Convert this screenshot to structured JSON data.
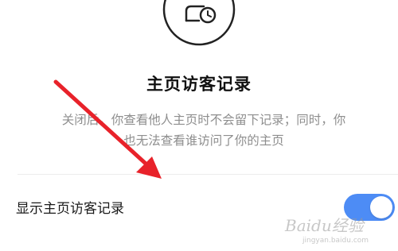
{
  "header": {
    "icon": "history-clock-icon"
  },
  "section": {
    "title": "主页访客记录",
    "description_line1": "关闭后，你查看他人主页时不会留下记录；同时，你",
    "description_line2": "也无法查看谁访问了你的主页"
  },
  "setting": {
    "label": "显示主页访客记录",
    "toggle_on": true,
    "toggle_color": "#4d8cf5"
  },
  "annotation": {
    "arrow_color": "#e8222a"
  },
  "watermark": {
    "brand": "Baidu经验",
    "url": "jingyan.baidu.com"
  }
}
